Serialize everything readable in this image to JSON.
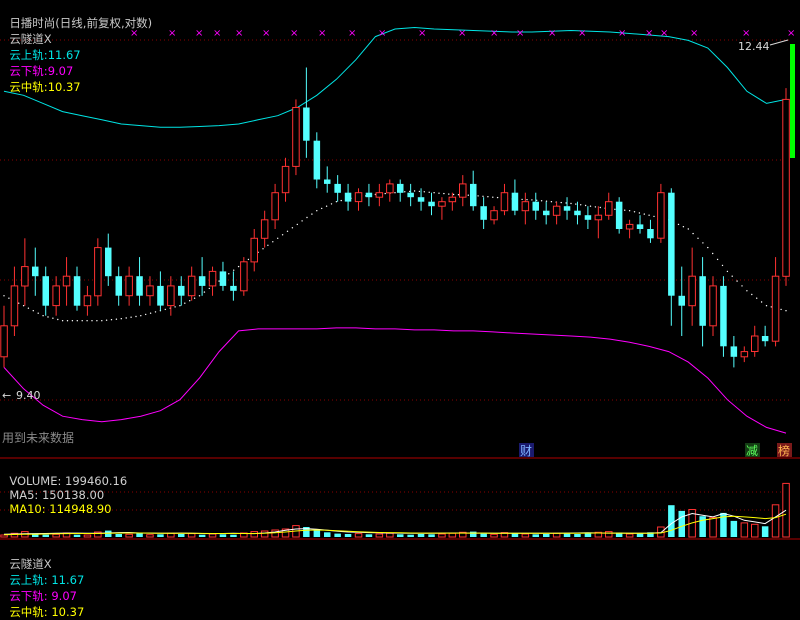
{
  "header": {
    "title": "日播时尚(日线,前复权,对数)",
    "indicator": "云隧道X",
    "upper_label": "云上轨:",
    "upper_value": "11.67",
    "lower_label": "云下轨:",
    "lower_value": "9.07",
    "middle_label": "云中轨:",
    "middle_value": "10.37"
  },
  "volume_header": {
    "volume_label": "VOLUME:",
    "volume_value": "199460.16",
    "ma5_label": "MA5:",
    "ma5_value": "150138.00",
    "ma10_label": "MA10:",
    "ma10_value": "114948.90"
  },
  "bottom_partial": {
    "indicator": "云隧道X",
    "upper_text": "云上轨: 11.67",
    "lower_text": "云下轨: 9.07",
    "middle_text": "云中轨: 10.37"
  },
  "annotations": {
    "high_price": "12.44",
    "low_price": "9.40",
    "future_data_note": "用到未来数据",
    "marker_finance": "财",
    "marker_reduce": "减",
    "marker_rank": "榜",
    "top_markers": [
      "×",
      "×",
      "××",
      "×",
      "××",
      "×",
      "×",
      "×",
      "×",
      "×",
      "×",
      "×",
      "××",
      "×",
      "×",
      "×",
      "×",
      "×",
      "×"
    ]
  },
  "colors": {
    "background": "#000000",
    "up_candle": "#ff3232",
    "down_candle": "#54ffff",
    "upper_band": "#00e5e5",
    "lower_band": "#ff00ff",
    "middle_dots": "#ffffff",
    "header_title": "#c8c8c8",
    "upper_text": "#00e5e5",
    "lower_text": "#ff00ff",
    "middle_text": "#ffff00",
    "grid": "#8b0000",
    "separator": "#b00000",
    "vol_ma5": "#ffffff",
    "vol_ma10": "#ffff00",
    "highlight_bar": "#00ff00"
  },
  "chart_data": {
    "type": "candlestick",
    "scale": "log",
    "ylim": [
      8.6,
      13.4
    ],
    "volume_ylim": [
      0,
      200000
    ],
    "candles": [
      [
        9.5,
        10.0,
        9.4,
        9.8
      ],
      [
        9.8,
        10.4,
        9.7,
        10.2
      ],
      [
        10.2,
        10.7,
        10.0,
        10.4
      ],
      [
        10.4,
        10.6,
        10.1,
        10.3
      ],
      [
        10.3,
        10.4,
        9.9,
        10.0
      ],
      [
        10.0,
        10.3,
        9.9,
        10.2
      ],
      [
        10.2,
        10.5,
        10.0,
        10.3
      ],
      [
        10.3,
        10.4,
        9.95,
        10.0
      ],
      [
        10.0,
        10.2,
        9.9,
        10.1
      ],
      [
        10.1,
        10.7,
        10.0,
        10.6
      ],
      [
        10.6,
        10.75,
        10.2,
        10.3
      ],
      [
        10.3,
        10.4,
        10.0,
        10.1
      ],
      [
        10.1,
        10.4,
        10.0,
        10.3
      ],
      [
        10.3,
        10.5,
        10.0,
        10.1
      ],
      [
        10.1,
        10.3,
        10.0,
        10.2
      ],
      [
        10.2,
        10.35,
        9.95,
        10.0
      ],
      [
        10.0,
        10.3,
        9.9,
        10.2
      ],
      [
        10.2,
        10.3,
        10.0,
        10.1
      ],
      [
        10.1,
        10.4,
        10.05,
        10.3
      ],
      [
        10.3,
        10.5,
        10.1,
        10.2
      ],
      [
        10.2,
        10.4,
        10.1,
        10.35
      ],
      [
        10.35,
        10.45,
        10.15,
        10.2
      ],
      [
        10.2,
        10.35,
        10.05,
        10.15
      ],
      [
        10.15,
        10.5,
        10.1,
        10.45
      ],
      [
        10.45,
        10.8,
        10.35,
        10.7
      ],
      [
        10.7,
        11.0,
        10.6,
        10.9
      ],
      [
        10.9,
        11.3,
        10.8,
        11.2
      ],
      [
        11.2,
        11.6,
        11.1,
        11.5
      ],
      [
        11.5,
        12.3,
        11.4,
        12.2
      ],
      [
        12.2,
        12.7,
        11.6,
        11.8
      ],
      [
        11.8,
        11.9,
        11.25,
        11.35
      ],
      [
        11.35,
        11.5,
        11.2,
        11.3
      ],
      [
        11.3,
        11.4,
        11.1,
        11.2
      ],
      [
        11.2,
        11.3,
        11.0,
        11.1
      ],
      [
        11.1,
        11.25,
        11.0,
        11.2
      ],
      [
        11.2,
        11.3,
        11.05,
        11.15
      ],
      [
        11.15,
        11.3,
        11.05,
        11.2
      ],
      [
        11.2,
        11.35,
        11.1,
        11.3
      ],
      [
        11.3,
        11.35,
        11.1,
        11.2
      ],
      [
        11.2,
        11.3,
        11.05,
        11.15
      ],
      [
        11.15,
        11.25,
        11.0,
        11.1
      ],
      [
        11.1,
        11.2,
        10.95,
        11.05
      ],
      [
        11.05,
        11.15,
        10.9,
        11.1
      ],
      [
        11.1,
        11.2,
        11.0,
        11.15
      ],
      [
        11.15,
        11.4,
        11.05,
        11.3
      ],
      [
        11.3,
        11.45,
        11.0,
        11.05
      ],
      [
        11.05,
        11.15,
        10.8,
        10.9
      ],
      [
        10.9,
        11.05,
        10.85,
        11.0
      ],
      [
        11.0,
        11.3,
        10.95,
        11.2
      ],
      [
        11.2,
        11.35,
        10.95,
        11.0
      ],
      [
        11.0,
        11.2,
        10.85,
        11.1
      ],
      [
        11.1,
        11.2,
        10.9,
        11.0
      ],
      [
        11.0,
        11.1,
        10.85,
        10.95
      ],
      [
        10.95,
        11.1,
        10.85,
        11.05
      ],
      [
        11.05,
        11.15,
        10.9,
        11.0
      ],
      [
        11.0,
        11.1,
        10.85,
        10.95
      ],
      [
        10.95,
        11.05,
        10.8,
        10.9
      ],
      [
        10.9,
        11.05,
        10.7,
        10.95
      ],
      [
        10.95,
        11.2,
        10.9,
        11.1
      ],
      [
        11.1,
        11.15,
        10.75,
        10.8
      ],
      [
        10.8,
        10.9,
        10.7,
        10.85
      ],
      [
        10.85,
        10.95,
        10.75,
        10.8
      ],
      [
        10.8,
        10.9,
        10.65,
        10.7
      ],
      [
        10.7,
        11.3,
        10.65,
        11.2
      ],
      [
        11.2,
        11.25,
        9.8,
        10.1
      ],
      [
        10.1,
        10.4,
        9.7,
        10.0
      ],
      [
        10.0,
        10.6,
        9.8,
        10.3
      ],
      [
        10.3,
        10.5,
        9.6,
        9.8
      ],
      [
        9.8,
        10.3,
        9.7,
        10.2
      ],
      [
        10.2,
        10.3,
        9.5,
        9.6
      ],
      [
        9.6,
        9.7,
        9.4,
        9.5
      ],
      [
        9.5,
        9.6,
        9.45,
        9.55
      ],
      [
        9.55,
        9.8,
        9.5,
        9.7
      ],
      [
        9.7,
        9.8,
        9.6,
        9.65
      ],
      [
        9.65,
        10.5,
        9.6,
        10.3
      ],
      [
        10.3,
        12.44,
        10.2,
        12.3
      ]
    ],
    "upper_band": [
      12.4,
      12.35,
      12.25,
      12.15,
      12.1,
      12.05,
      12.0,
      11.98,
      11.96,
      11.96,
      11.97,
      11.98,
      12.0,
      12.05,
      12.1,
      12.2,
      12.35,
      12.55,
      12.8,
      13.1,
      13.2,
      13.22,
      13.2,
      13.19,
      13.18,
      13.17,
      13.16,
      13.16,
      13.17,
      13.18,
      13.17,
      13.16,
      13.14,
      13.12,
      13.1,
      13.05,
      12.95,
      12.7,
      12.4,
      12.25,
      12.3
    ],
    "lower_band": [
      9.4,
      9.2,
      9.05,
      8.95,
      8.92,
      8.9,
      8.92,
      8.95,
      9.0,
      9.1,
      9.3,
      9.55,
      9.75,
      9.77,
      9.77,
      9.77,
      9.77,
      9.78,
      9.78,
      9.77,
      9.77,
      9.76,
      9.76,
      9.75,
      9.75,
      9.74,
      9.73,
      9.72,
      9.71,
      9.7,
      9.69,
      9.67,
      9.64,
      9.6,
      9.55,
      9.45,
      9.3,
      9.1,
      8.95,
      8.85,
      8.8
    ],
    "middle_line": [
      10.1,
      10.0,
      9.9,
      9.85,
      9.85,
      9.85,
      9.87,
      9.9,
      9.95,
      10.0,
      10.1,
      10.25,
      10.4,
      10.55,
      10.7,
      10.85,
      11.0,
      11.1,
      11.15,
      11.18,
      11.2,
      11.22,
      11.2,
      11.18,
      11.17,
      11.15,
      11.13,
      11.12,
      11.1,
      11.08,
      11.05,
      11.02,
      11.0,
      10.95,
      10.9,
      10.8,
      10.6,
      10.35,
      10.15,
      10.0,
      9.95
    ],
    "volume_ma5": [
      8000,
      9000,
      9500,
      10000,
      10500,
      11000,
      11500,
      11500,
      11000,
      11000,
      12000,
      13000,
      13500,
      12000,
      11500,
      11000,
      11000,
      11500,
      11000,
      10500,
      10000,
      10500,
      11000,
      10500,
      10000,
      12000,
      15000,
      20000,
      24000,
      25000,
      23000,
      20000,
      17000,
      15000,
      14000,
      13000,
      12500,
      12000,
      11500,
      11000,
      11000,
      11000,
      11500,
      12000,
      12000,
      11500,
      11500,
      11000,
      11000,
      11000,
      11000,
      11000,
      11000,
      11000,
      11500,
      12000,
      12500,
      12000,
      11500,
      11500,
      11000,
      11000,
      11500,
      13000,
      40000,
      60000,
      70000,
      65000,
      60000,
      70000,
      62000,
      50000,
      45000,
      40000,
      60000,
      80000
    ],
    "volume_ma10": [
      7000,
      7500,
      8000,
      8500,
      9000,
      9500,
      10000,
      10500,
      10500,
      10500,
      11000,
      11500,
      12000,
      12000,
      11500,
      11200,
      11000,
      11000,
      11000,
      10800,
      10500,
      10300,
      10500,
      10500,
      10500,
      11000,
      12500,
      15000,
      18000,
      20000,
      21000,
      20000,
      18500,
      17000,
      15500,
      14500,
      13500,
      13000,
      12500,
      12000,
      11500,
      11500,
      11500,
      11500,
      11500,
      11500,
      11500,
      11300,
      11200,
      11000,
      11000,
      11000,
      11000,
      11000,
      11200,
      11400,
      11700,
      11800,
      11700,
      11600,
      11400,
      11300,
      11300,
      11800,
      20000,
      32000,
      42000,
      50000,
      55000,
      60000,
      62000,
      60000,
      58000,
      55000,
      58000,
      68000
    ],
    "volumes": [
      6000,
      11000,
      16000,
      9000,
      7000,
      8000,
      12000,
      7000,
      6000,
      15000,
      19000,
      9000,
      8000,
      12000,
      7000,
      8000,
      11000,
      9000,
      10000,
      7000,
      9000,
      8000,
      7000,
      12000,
      16000,
      18000,
      21000,
      24000,
      34000,
      30000,
      21000,
      14000,
      10000,
      9000,
      10000,
      8000,
      9000,
      11000,
      8000,
      7000,
      9000,
      8000,
      9000,
      11000,
      14000,
      16000,
      10000,
      8000,
      13000,
      12000,
      9000,
      8000,
      9000,
      11000,
      10000,
      9000,
      12000,
      14000,
      16000,
      13000,
      9000,
      10000,
      14000,
      30000,
      95000,
      78000,
      82000,
      62000,
      58000,
      72000,
      48000,
      42000,
      38000,
      32000,
      96000,
      160000
    ]
  }
}
